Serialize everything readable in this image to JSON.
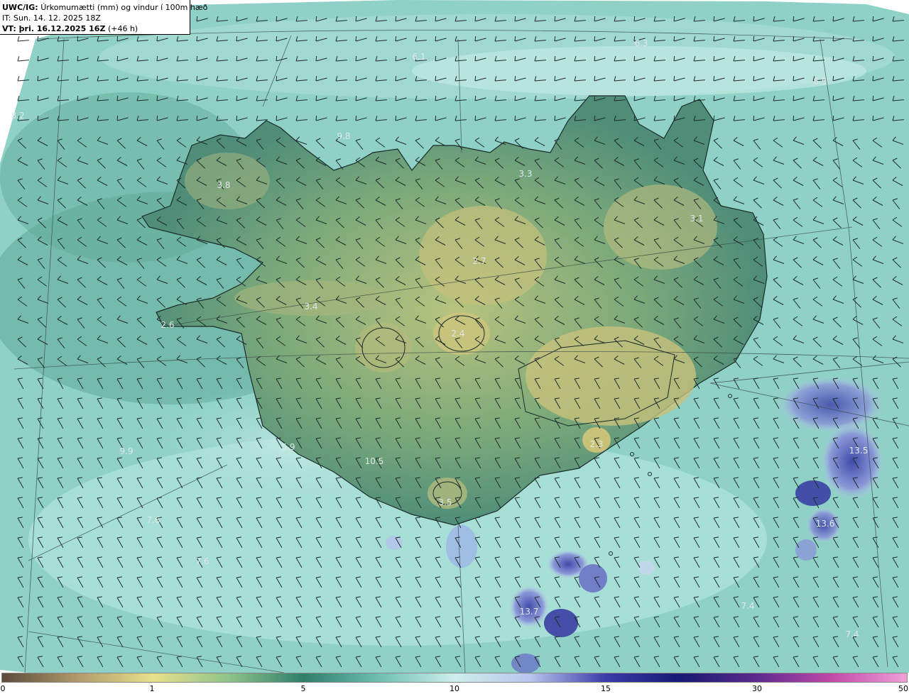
{
  "header": {
    "model": "UWC/IG:",
    "title": "Úrkomumætti (mm) og vindur í 100m hæð",
    "issue_time": "IT: Sun. 14. 12. 2025 18Z",
    "valid_label": "VT: þri. 16.12.2025 16Z",
    "lead": "(+46 h)"
  },
  "colorbar": {
    "ticks": [
      "0",
      "1",
      "5",
      "10",
      "15",
      "30",
      "50"
    ],
    "tick_values": [
      0,
      1,
      5,
      10,
      15,
      30,
      50
    ],
    "colors": [
      "#5c4a3a",
      "#b09a6a",
      "#e8e08a",
      "#8fc48a",
      "#2e7e6a",
      "#6fbfb0",
      "#cdeeea",
      "#b8c6ec",
      "#3c3ca8",
      "#161a72",
      "#5a2a8e",
      "#c04aa8",
      "#f0a0d8"
    ]
  },
  "values": [
    "6.1",
    "6.3",
    "6.5",
    "8.2",
    "9.8",
    "3.3",
    "3.8",
    "3.1",
    "2.7",
    "3.4",
    "2.6",
    "2.4",
    "5.9",
    "10.5",
    "9.9",
    "13.5",
    "2.3",
    "3.5",
    "7.6",
    "7.6",
    "13.6",
    "13.7",
    "7.4",
    "7.4"
  ]
}
